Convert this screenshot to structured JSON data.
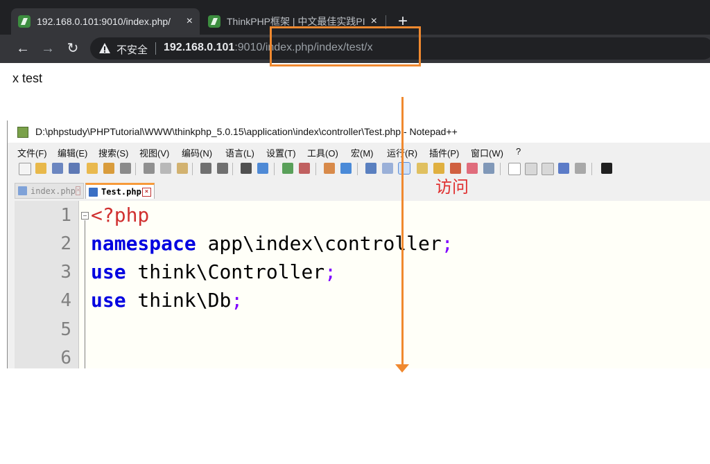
{
  "browser": {
    "tabs": [
      {
        "title": "192.168.0.101:9010/index.php/",
        "close": "×"
      },
      {
        "title": "ThinkPHP框架 | 中文最佳实践PI",
        "close": "×"
      }
    ],
    "new_tab": "+",
    "nav": {
      "back": "←",
      "forward": "→",
      "reload": "↻"
    },
    "security_label": "不安全",
    "url_host": "192.168.0.101",
    "url_rest": ":9010/index.php/index/test/x"
  },
  "page": {
    "body_text": "x test"
  },
  "notepad": {
    "title": "D:\\phpstudy\\PHPTutorial\\WWW\\thinkphp_5.0.15\\application\\index\\controller\\Test.php - Notepad++",
    "menu": [
      "文件(F)",
      "编辑(E)",
      "搜索(S)",
      "视图(V)",
      "编码(N)",
      "语言(L)",
      "设置(T)",
      "工具(O)",
      "宏(M)",
      "运行(R)",
      "插件(P)",
      "窗口(W)",
      "?"
    ],
    "file_tabs": [
      {
        "label": "index.php",
        "close": "×"
      },
      {
        "label": "Test.php",
        "close": "×"
      }
    ],
    "line_numbers": [
      "1",
      "2",
      "3",
      "4",
      "5",
      "6"
    ],
    "code": {
      "l1": "<?php",
      "l2_kw": "namespace",
      "l2_rest": " app\\index\\controller",
      "l3_kw": "use",
      "l3_rest": " think\\Controller",
      "l4_kw": "use",
      "l4_rest": " think\\Db",
      "semicolon": ";"
    }
  },
  "annotation": {
    "text": "访问",
    "color": "#e03030",
    "arrow_color": "#f0892f"
  }
}
